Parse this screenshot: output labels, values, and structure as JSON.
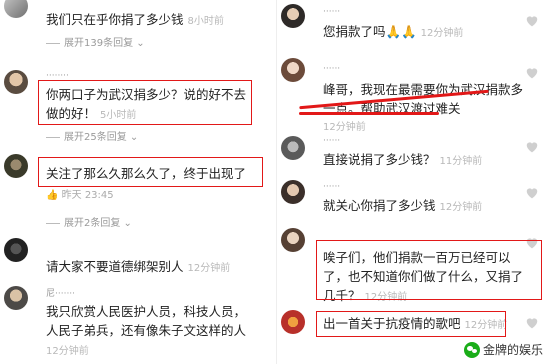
{
  "left_comments": [
    {
      "user": "",
      "text": "我们只在乎你捐了多少钱",
      "time": "8小时前",
      "reply": "展开139条回复"
    },
    {
      "user": "",
      "text_lines": [
        "你两口子为武汉捐多少？说的好不去",
        "做的好！"
      ],
      "time": "5小时前",
      "reply": "展开25条回复"
    },
    {
      "user": "",
      "text": "关注了那么久那么久了，终于出现了",
      "time_prefix": "昨天 23:45",
      "reply": "展开2条回复"
    },
    {
      "user": "",
      "text": "请大家不要道德绑架别人",
      "time": "12分钟前"
    },
    {
      "user": "",
      "text_lines": [
        "我只欣赏人民医护人员，科技人员，",
        "人民子弟兵，还有像朱子文这样的人"
      ],
      "time": "12分钟前"
    }
  ],
  "right_comments": [
    {
      "user": "",
      "text": "您捐款了吗🙏🙏",
      "time": "12分钟前"
    },
    {
      "user": "",
      "text_lines": [
        "峰哥，我现在最需要你为武汉捐款多",
        "一点。帮助武汉渡过难关"
      ],
      "time": "12分钟前"
    },
    {
      "user": "",
      "text": "直接说捐了多少钱？",
      "time": "11分钟前"
    },
    {
      "user": "",
      "text": "就关心你捐了多少钱",
      "time": "12分钟前"
    },
    {
      "user": "",
      "text_lines": [
        "唉子们，他们捐款一百万已经可以",
        "了，也不知道你们做了什么，又捐了",
        "几千？"
      ],
      "time": "12分钟前"
    },
    {
      "user": "",
      "text": "出一首关于抗疫情的歌吧",
      "time": "12分钟前"
    }
  ],
  "watermark": "金牌的娱乐",
  "colors": {
    "red": "#e21818",
    "grey_text": "#b8b8b8"
  }
}
